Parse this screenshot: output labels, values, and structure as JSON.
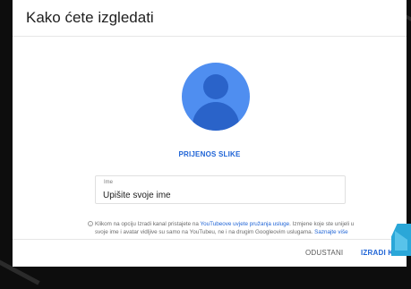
{
  "dialog": {
    "title": "Kako ćete izgledati"
  },
  "avatar": {
    "upload_label": "PRIJENOS SLIKE"
  },
  "name_field": {
    "label": "Ime",
    "placeholder": "Upišite svoje ime"
  },
  "info": {
    "text_before_link": "Klikom na opciju Izradi kanal pristajete na ",
    "terms_link": "YouTubeove uvjete pružanja usluge",
    "text_after_link": ". Izmjene koje ste unijeli u svoje ime i avatar vidljive su samo na YouTubeu, ne i na drugim Googleovim uslugama. ",
    "learn_more": "Saznajte više"
  },
  "footer": {
    "cancel_label": "ODUSTANI",
    "create_label": "IZRADI KANA"
  },
  "colors": {
    "accent": "#1f64d6",
    "avatar_bg": "#4f8ef0",
    "avatar_fg": "#2a63c9"
  }
}
